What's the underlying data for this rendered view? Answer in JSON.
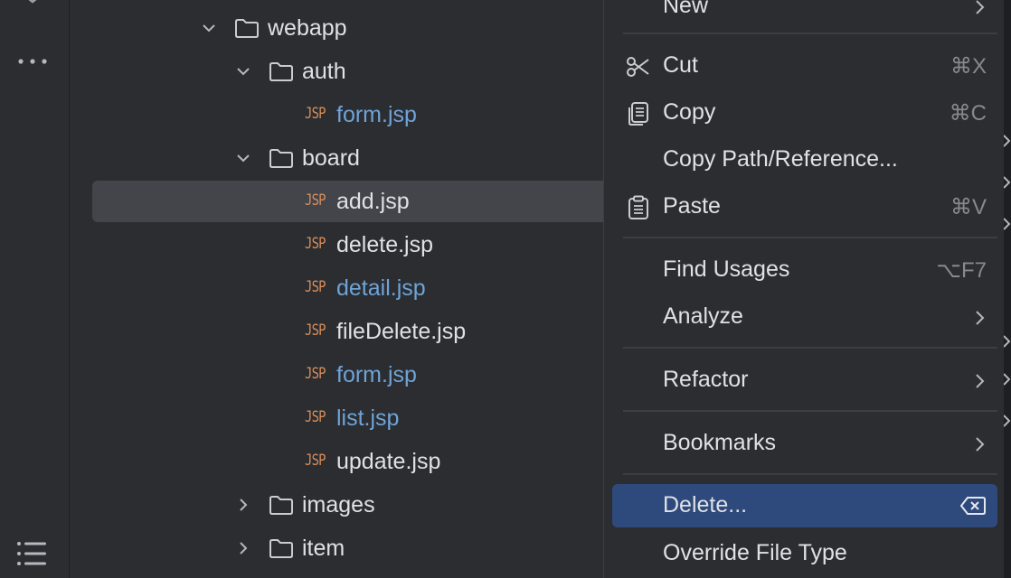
{
  "colors": {
    "panel_bg": "#2b2d30",
    "selection_bg": "#43454a",
    "menu_active_bg": "#2e4a7d",
    "text_primary": "#dfe1e5",
    "text_vcs_blue": "#6fa3d8",
    "jsp_orange": "#d98d5b",
    "shortcut_gray": "#86898e"
  },
  "toolstrip": {
    "more_icon": "more-horizontal-icon",
    "structure_icon": "list-icon"
  },
  "tree": {
    "items": [
      {
        "label": "webapp",
        "type": "folder",
        "expanded": true
      },
      {
        "label": "auth",
        "type": "folder",
        "expanded": true
      },
      {
        "label": "form.jsp",
        "type": "jsp",
        "badge": "JSP"
      },
      {
        "label": "board",
        "type": "folder",
        "expanded": true
      },
      {
        "label": "add.jsp",
        "type": "jsp",
        "badge": "JSP",
        "selected": true
      },
      {
        "label": "delete.jsp",
        "type": "jsp",
        "badge": "JSP"
      },
      {
        "label": "detail.jsp",
        "type": "jsp",
        "badge": "JSP"
      },
      {
        "label": "fileDelete.jsp",
        "type": "jsp",
        "badge": "JSP"
      },
      {
        "label": "form.jsp",
        "type": "jsp",
        "badge": "JSP"
      },
      {
        "label": "list.jsp",
        "type": "jsp",
        "badge": "JSP"
      },
      {
        "label": "update.jsp",
        "type": "jsp",
        "badge": "JSP"
      },
      {
        "label": "images",
        "type": "folder",
        "expanded": false
      },
      {
        "label": "item",
        "type": "folder",
        "expanded": false
      }
    ]
  },
  "context_menu": {
    "items": [
      {
        "label": "New",
        "submenu": true
      },
      {
        "label": "Cut",
        "shortcut": "⌘X",
        "icon": "scissors-icon"
      },
      {
        "label": "Copy",
        "shortcut": "⌘C",
        "icon": "copy-icon"
      },
      {
        "label": "Copy Path/Reference..."
      },
      {
        "label": "Paste",
        "shortcut": "⌘V",
        "icon": "clipboard-icon"
      },
      {
        "label": "Find Usages",
        "shortcut": "⌥F7"
      },
      {
        "label": "Analyze",
        "submenu": true
      },
      {
        "label": "Refactor",
        "submenu": true
      },
      {
        "label": "Bookmarks",
        "submenu": true
      },
      {
        "label": "Delete...",
        "icon": "delete-key-icon",
        "active": true
      },
      {
        "label": "Override File Type"
      }
    ]
  }
}
